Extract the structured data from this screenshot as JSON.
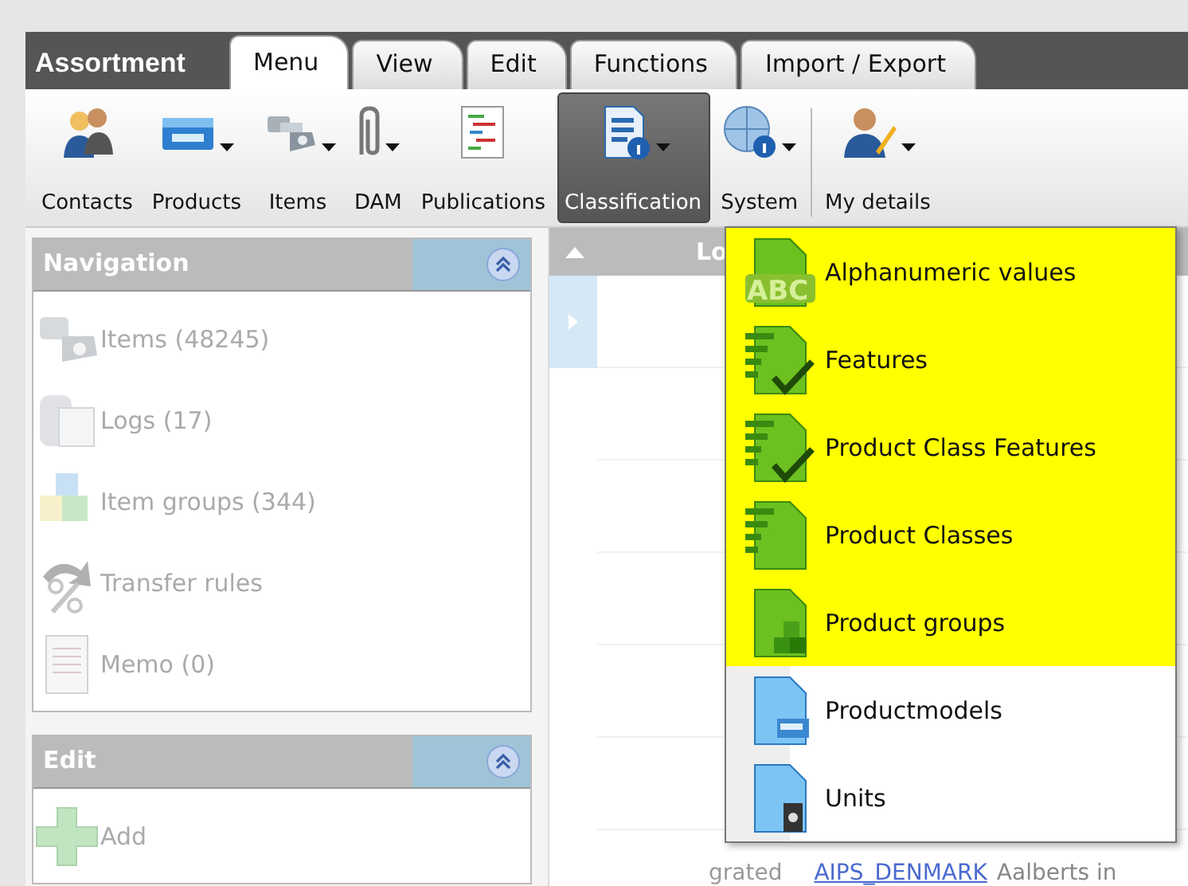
{
  "app_title": "Assortment",
  "tabs": [
    {
      "label": "Menu",
      "selected": true
    },
    {
      "label": "View",
      "selected": false
    },
    {
      "label": "Edit",
      "selected": false
    },
    {
      "label": "Functions",
      "selected": false
    },
    {
      "label": "Import / Export",
      "selected": false
    }
  ],
  "toolbar": [
    {
      "label": "Contacts",
      "dropdown": false,
      "selected": false
    },
    {
      "label": "Products",
      "dropdown": true,
      "selected": false
    },
    {
      "label": "Items",
      "dropdown": true,
      "selected": false
    },
    {
      "label": "DAM",
      "dropdown": true,
      "selected": false
    },
    {
      "label": "Publications",
      "dropdown": false,
      "selected": false
    },
    {
      "label": "Classification",
      "dropdown": true,
      "selected": true
    },
    {
      "label": "System",
      "dropdown": true,
      "selected": false
    },
    {
      "label": "My details",
      "dropdown": true,
      "selected": false
    }
  ],
  "navigation": {
    "title": "Navigation",
    "items": [
      {
        "label": "Items (48245)",
        "disabled": true
      },
      {
        "label": "Logs (17)",
        "disabled": true
      },
      {
        "label": "Item groups (344)",
        "disabled": true
      },
      {
        "label": "Transfer rules",
        "disabled": true
      },
      {
        "label": "Memo (0)",
        "disabled": true
      }
    ]
  },
  "edit_panel": {
    "title": "Edit",
    "items": [
      {
        "label": "Add",
        "disabled": true
      }
    ]
  },
  "grid": {
    "column_1": "Lo",
    "bottom_row": {
      "column_1": "grated",
      "column_2": "AIPS_DENMARK",
      "column_3": "Aalberts in"
    }
  },
  "dropdown_menu": [
    {
      "label": "Alphanumeric values",
      "highlighted": true,
      "icon_text": "ABC"
    },
    {
      "label": "Features",
      "highlighted": true
    },
    {
      "label": "Product Class Features",
      "highlighted": true
    },
    {
      "label": "Product Classes",
      "highlighted": true
    },
    {
      "label": "Product groups",
      "highlighted": true
    },
    {
      "label": "Productmodels",
      "highlighted": false
    },
    {
      "label": "Units",
      "highlighted": false
    }
  ]
}
